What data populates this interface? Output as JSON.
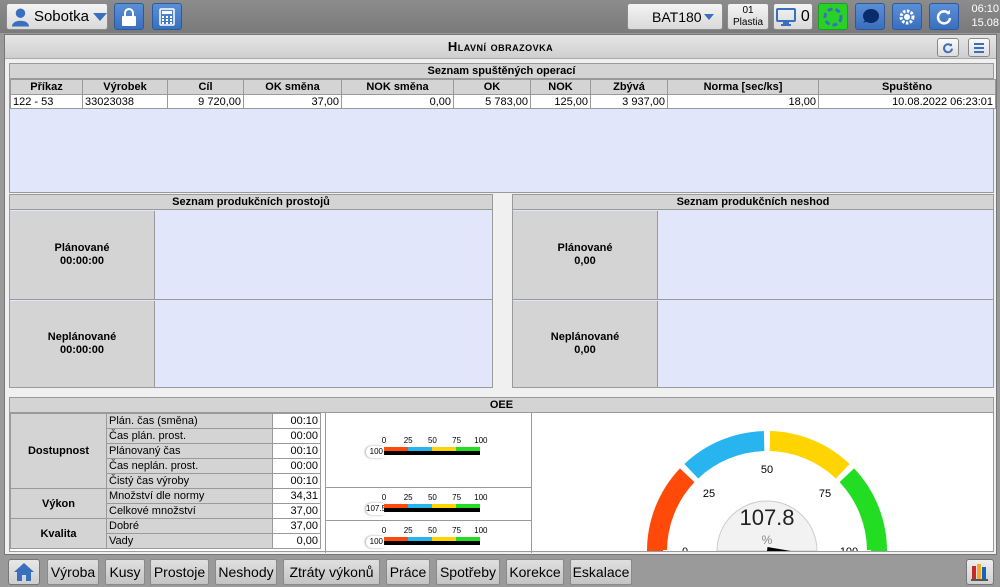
{
  "topbar": {
    "user": "Sobotka",
    "station": "BAT180",
    "shift_number": "01",
    "shift_location": "Plastia",
    "monitor_count": "0",
    "time": "06:10",
    "date": "15.08"
  },
  "main": {
    "title": "Hlavní obrazovka"
  },
  "operations": {
    "title": "Seznam spuštěných operací",
    "columns": [
      "Příkaz",
      "Výrobek",
      "Cíl",
      "OK směna",
      "NOK směna",
      "OK",
      "NOK",
      "Zbývá",
      "Norma [sec/ks]",
      "Spuštěno"
    ],
    "rows": [
      [
        "122 - 53",
        "33023038",
        "9 720,00",
        "37,00",
        "0,00",
        "5 783,00",
        "125,00",
        "3 937,00",
        "18,00",
        "10.08.2022 06:23:01"
      ]
    ]
  },
  "downtimes": {
    "title": "Seznam produkčních prostojů",
    "planned_label": "Plánované",
    "planned_value": "00:00:00",
    "unplanned_label": "Neplánované",
    "unplanned_value": "00:00:00"
  },
  "defects": {
    "title": "Seznam produkčních neshod",
    "planned_label": "Plánované",
    "planned_value": "0,00",
    "unplanned_label": "Neplánované",
    "unplanned_value": "0,00"
  },
  "oee": {
    "title": "OEE",
    "availability": {
      "group": "Dostupnost",
      "rows": [
        {
          "label": "Plán. čas (směna)",
          "value": "00:10"
        },
        {
          "label": "Čas plán. prost.",
          "value": "00:00"
        },
        {
          "label": "Plánovaný čas",
          "value": "00:10"
        },
        {
          "label": "Čas neplán. prost.",
          "value": "00:00"
        },
        {
          "label": "Čistý čas výroby",
          "value": "00:10"
        }
      ],
      "gauge_value": "100"
    },
    "performance": {
      "group": "Výkon",
      "rows": [
        {
          "label": "Množství dle normy",
          "value": "34,31"
        },
        {
          "label": "Celkové množství",
          "value": "37,00"
        }
      ],
      "gauge_value": "107.5"
    },
    "quality": {
      "group": "Kvalita",
      "rows": [
        {
          "label": "Dobré",
          "value": "37,00"
        },
        {
          "label": "Vady",
          "value": "0,00"
        }
      ],
      "gauge_value": "100"
    },
    "mini_ticks": [
      "0",
      "25",
      "50",
      "75",
      "100"
    ],
    "mini_colors": [
      "#ff4a0a",
      "#28b4ee",
      "#ffd400",
      "#22dd22"
    ],
    "big_gauge": {
      "value": 107.8,
      "display": "107.8",
      "unit": "%",
      "ticks": [
        "0",
        "25",
        "50",
        "75",
        "100"
      ],
      "colors": [
        "#ff4a0a",
        "#28b4ee",
        "#ffd400",
        "#22dd22"
      ]
    }
  },
  "bottom_tabs": [
    "Výroba",
    "Kusy",
    "Prostoje",
    "Neshody",
    "Ztráty výkonů",
    "Práce",
    "Spotřeby",
    "Korekce",
    "Eskalace"
  ],
  "icons": {
    "user": "user-icon",
    "lock": "lock-icon",
    "calculator": "calculator-icon",
    "monitor": "monitor-icon",
    "status": "status-ring-icon",
    "bubble": "chat-bubble-icon",
    "settings": "gear-icon",
    "refresh": "refresh-icon",
    "home": "home-icon",
    "menu": "menu-icon",
    "books": "books-icon"
  }
}
